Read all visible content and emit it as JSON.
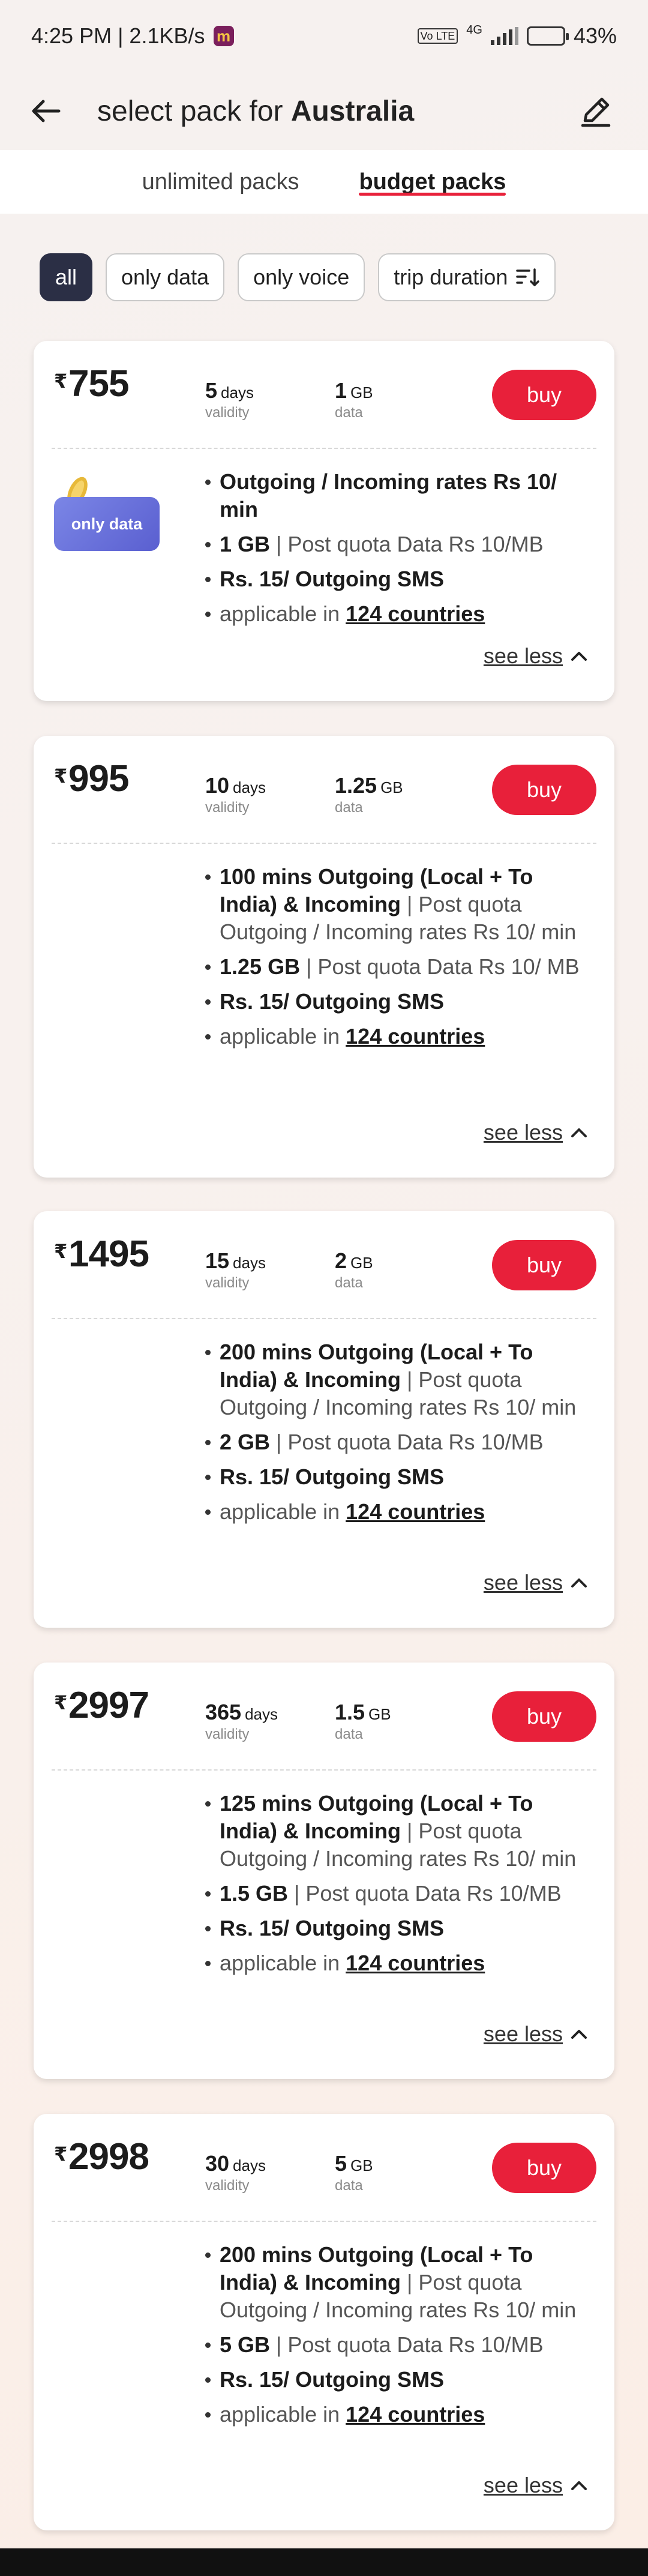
{
  "status": {
    "time_speed": "4:25 PM | 2.1KB/s",
    "app_icon_letter": "m",
    "network_tag": "Vo LTE",
    "network_type": "4G",
    "battery_percent": "43%",
    "battery_level": 0.43
  },
  "header": {
    "title_prefix": "select pack for ",
    "title_country": "Australia"
  },
  "tabs": [
    {
      "label": "unlimited packs",
      "active": false
    },
    {
      "label": "budget packs",
      "active": true
    }
  ],
  "filters": [
    {
      "label": "all",
      "active": true
    },
    {
      "label": "only data",
      "active": false
    },
    {
      "label": "only voice",
      "active": false
    },
    {
      "label": "trip duration",
      "active": false
    }
  ],
  "packs": [
    {
      "currency": "₹",
      "price": "755",
      "days": "5",
      "days_unit": "days",
      "days_cap": "validity",
      "data": "1",
      "data_unit": "GB",
      "data_cap": "data",
      "buy": "buy",
      "badge": "only data",
      "b1_bold": "Outgoing / Incoming rates  Rs 10/ min",
      "b1_rest": "",
      "b2_bold": "1 GB",
      "b2_rest": " | Post quota Data  Rs 10/MB",
      "b3": "Rs. 15/ Outgoing SMS",
      "b4_pre": "applicable in ",
      "b4_link": "124 countries",
      "see_less": "see less"
    },
    {
      "currency": "₹",
      "price": "995",
      "days": "10",
      "days_unit": "days",
      "days_cap": "validity",
      "data": "1.25",
      "data_unit": "GB",
      "data_cap": "data",
      "buy": "buy",
      "b1_bold": "100 mins Outgoing (Local + To India) & Incoming",
      "b1_rest": " | Post quota Outgoing / Incoming rates  Rs 10/ min",
      "b2_bold": "1.25 GB",
      "b2_rest": " | Post quota Data  Rs 10/ MB",
      "b3": "Rs. 15/ Outgoing SMS",
      "b4_pre": "applicable in ",
      "b4_link": "124 countries",
      "see_less": "see less"
    },
    {
      "currency": "₹",
      "price": "1495",
      "days": "15",
      "days_unit": "days",
      "days_cap": "validity",
      "data": "2",
      "data_unit": "GB",
      "data_cap": "data",
      "buy": "buy",
      "b1_bold": "200 mins Outgoing (Local + To India) & Incoming",
      "b1_rest": " | Post quota Outgoing / Incoming rates  Rs 10/ min",
      "b2_bold": "2 GB",
      "b2_rest": " | Post quota Data  Rs 10/MB",
      "b3": "Rs. 15/ Outgoing SMS",
      "b4_pre": "applicable in ",
      "b4_link": "124 countries",
      "see_less": "see less"
    },
    {
      "currency": "₹",
      "price": "2997",
      "days": "365",
      "days_unit": "days",
      "days_cap": "validity",
      "data": "1.5",
      "data_unit": "GB",
      "data_cap": "data",
      "buy": "buy",
      "b1_bold": "125 mins Outgoing (Local + To India) & Incoming",
      "b1_rest": " | Post quota Outgoing / Incoming rates  Rs 10/ min",
      "b2_bold": "1.5 GB",
      "b2_rest": " | Post quota Data  Rs 10/MB",
      "b3": "Rs. 15/ Outgoing SMS",
      "b4_pre": "applicable in ",
      "b4_link": "124 countries",
      "see_less": "see less"
    },
    {
      "currency": "₹",
      "price": "2998",
      "days": "30",
      "days_unit": "days",
      "days_cap": "validity",
      "data": "5",
      "data_unit": "GB",
      "data_cap": "data",
      "buy": "buy",
      "b1_bold": "200 mins Outgoing (Local + To India) & Incoming",
      "b1_rest": " | Post quota Outgoing / Incoming rates  Rs 10/ min",
      "b2_bold": "5 GB",
      "b2_rest": " | Post quota Data  Rs 10/MB",
      "b3": "Rs. 15/ Outgoing SMS",
      "b4_pre": "applicable in ",
      "b4_link": "124 countries",
      "see_less": "see less"
    }
  ],
  "colors": {
    "accent": "#e8203a",
    "chip_active": "#2b2f45"
  }
}
